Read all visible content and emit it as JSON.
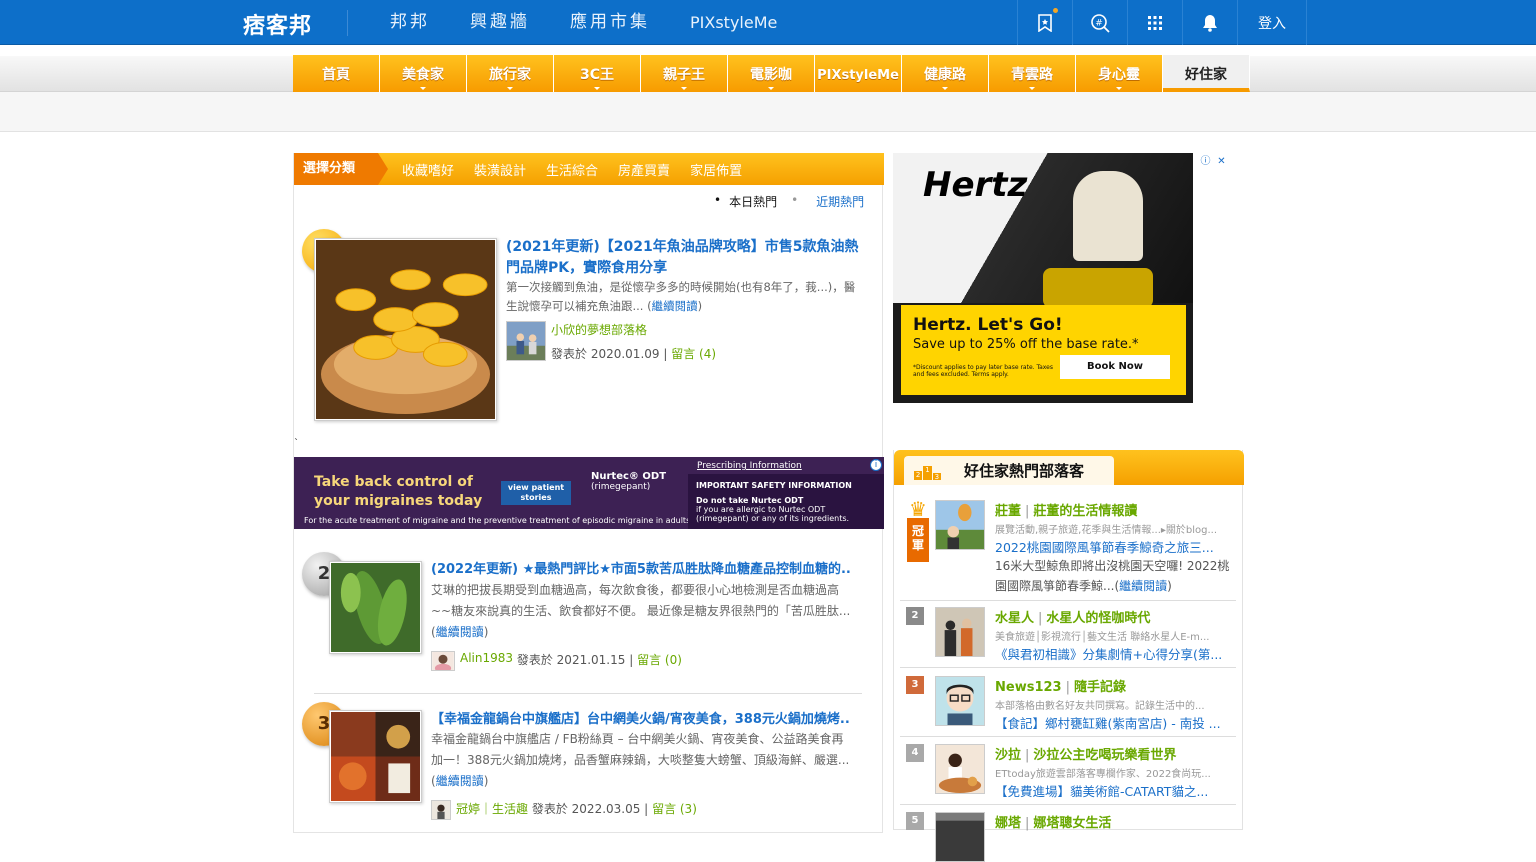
{
  "header": {
    "logo_text": "痞客邦",
    "nav": [
      "邦邦",
      "興趣牆",
      "應用市集",
      "PIXstyleMe"
    ],
    "icons": [
      "bookmark-icon",
      "hashtag-search-icon",
      "apps-grid-icon",
      "bell-icon"
    ],
    "login_label": "登入",
    "brand_color": "#0d6fc9"
  },
  "categories": {
    "items": [
      "首頁",
      "美食家",
      "旅行家",
      "3C王",
      "親子王",
      "電影咖",
      "PIXstyleMe",
      "健康路",
      "青雲路",
      "身心靈",
      "好住家"
    ],
    "active": "好住家",
    "accent_color": "#f79b00"
  },
  "subnav": {
    "select_label": "選擇分類",
    "items": [
      "收藏嗜好",
      "裝潢設計",
      "生活綜合",
      "房產買賣",
      "家居佈置"
    ]
  },
  "hot_switch": {
    "today": "本日熱門",
    "recent": "近期熱門"
  },
  "articles": [
    {
      "rank": "1",
      "title": "(2021年更新)【2021年魚油品牌攻略】市售5款魚油熱門品牌PK，實際食用分享",
      "desc": "第一次接觸到魚油，是從懷孕多多的時候開始(也有8年了，莪...)，醫生說懷孕可以補充魚油跟... (",
      "more": "繼續閱讀",
      "desc_end": ")",
      "author": "小欣的夢想部落格",
      "posted": "發表於 2020.01.09 |",
      "comments": "留言 (4)"
    },
    {
      "rank": "2",
      "title": "(2022年更新) ★最熱門評比★市面5款苦瓜胜肽降血糖產品控制血糖的...",
      "desc": "艾琳的把拔長期受到血糖過高，每次飲食後，都要很小心地檢測是否血糖過高~~糖友來說真的生活、飲食都好不便。 最近像是糖友界很熱門的「苦瓜胜肽... (",
      "more": "繼續閱讀",
      "desc_end": ")",
      "author": "Alin1983",
      "posted": "發表於 2021.01.15 |",
      "comments": "留言 (0)"
    },
    {
      "rank": "3",
      "title": "【幸福金龍鍋台中旗艦店】台中網美火鍋/宵夜美食，388元火鍋加燒烤...",
      "desc": "幸福金龍鍋台中旗艦店 / FB粉絲頁 – 台中網美火鍋、宵夜美食、公益路美食再加一！388元火鍋加燒烤，品香蟹麻辣鍋，大啖整隻大螃蟹、頂級海鮮、嚴選... (",
      "more": "繼續閱讀",
      "desc_end": ")",
      "author": "冠婷｜生活趣",
      "posted": "發表於 2022.03.05 |",
      "comments": "留言 (3)"
    }
  ],
  "tick_char": "`",
  "ad_nurtec": {
    "headline_1": "Take back control of",
    "headline_2": "your migraines today",
    "button": "view patient stories",
    "brand": "Nurtec® ODT",
    "brand_sub": "(rimegepant)",
    "footnote": "For the acute treatment of migraine and the preventive treatment of episodic migraine in adults.",
    "pi_link": "Prescribing Information",
    "isi_title": "IMPORTANT SAFETY INFORMATION",
    "isi_1": "Do not take Nurtec ODT",
    "isi_2": "if you are allergic to Nurtec ODT (rimegepant) or any of its ingredients."
  },
  "ad_hertz": {
    "logo": "Hertz",
    "title": "Hertz. Let's Go!",
    "line": "Save up to 25% off the base rate.*",
    "fine": "*Discount applies to pay later base rate. Taxes and fees excluded. Terms apply.",
    "button": "Book Now"
  },
  "hot_blogs": {
    "title": "好住家熱門部落客",
    "champion_label": "冠軍",
    "items": [
      {
        "rank": "1",
        "blogger": "莊董",
        "blog": "莊董的生活情報讀",
        "desc": "展覽活動,親子旅遊,花季與生活情報...▸關於blog...",
        "post": "2022桃園國際風箏節春季鯨奇之旅三...",
        "excerpt": "16米大型鯨魚即將出沒桃園天空囉! 2022桃園國際風箏節春季鯨...(",
        "more": "繼續閱讀",
        "excerpt_end": ")"
      },
      {
        "rank": "2",
        "blogger": "水星人",
        "blog": "水星人的怪咖時代",
        "desc": "美食旅遊│影視流行│藝文生活 聯絡水星人E-m...",
        "post": "《與君初相識》分集劇情+心得分享(第..."
      },
      {
        "rank": "3",
        "blogger": "News123",
        "blog": "隨手記錄",
        "desc": "本部落格由數名好友共同撰寫。記錄生活中的...",
        "post": "【食記】鄉村甕缸雞(紫南宮店) - 南投 ..."
      },
      {
        "rank": "4",
        "blogger": "沙拉",
        "blog": "沙拉公主吃喝玩樂看世界",
        "desc": "ETtoday旅遊雲部落客專欄作家、2022食尚玩...",
        "post": "【免費進場】貓美術館-CATART貓之..."
      },
      {
        "rank": "5",
        "blogger": "娜塔",
        "blog": "娜塔聰女生活",
        "desc": "",
        "post": ""
      }
    ]
  }
}
